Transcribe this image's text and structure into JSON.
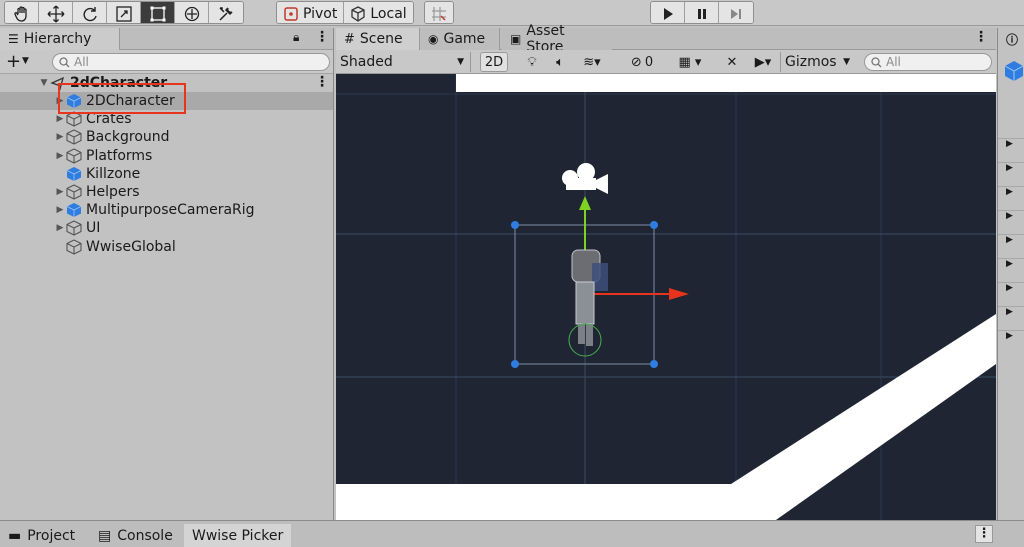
{
  "toolbar": {
    "tools": [
      "hand-tool",
      "move-tool",
      "rotate-tool",
      "scale-tool",
      "rect-tool",
      "transform-tool",
      "custom-tool"
    ],
    "pivot_label": "Pivot",
    "local_label": "Local"
  },
  "hierarchy": {
    "tab_label": "Hierarchy",
    "search_placeholder": "All",
    "scene_root": "2dCharacter",
    "items": [
      {
        "label": "2DCharacter",
        "icon": "blue-cube-icon",
        "expandable": true,
        "selected": true
      },
      {
        "label": "Crates",
        "icon": "outline-cube-icon",
        "expandable": true
      },
      {
        "label": "Background",
        "icon": "outline-cube-icon",
        "expandable": true
      },
      {
        "label": "Platforms",
        "icon": "outline-cube-icon",
        "expandable": true
      },
      {
        "label": "Killzone",
        "icon": "blue-cube-icon",
        "expandable": false
      },
      {
        "label": "Helpers",
        "icon": "outline-cube-icon",
        "expandable": true
      },
      {
        "label": "MultipurposeCameraRig",
        "icon": "blue-cube-icon",
        "expandable": true
      },
      {
        "label": "UI",
        "icon": "outline-cube-icon",
        "expandable": true
      },
      {
        "label": "WwiseGlobal",
        "icon": "outline-cube-icon",
        "expandable": false
      }
    ]
  },
  "scene": {
    "tabs": [
      "Scene",
      "Game",
      "Asset Store"
    ],
    "shading": "Shaded",
    "mode_2d": "2D",
    "hidden_count": "0",
    "gizmos": "Gizmos",
    "search_placeholder": "All"
  },
  "bottom": {
    "tabs": [
      "Project",
      "Console",
      "Wwise Picker"
    ]
  },
  "colors": {
    "viewport_bg": "#1f2533",
    "grid": "#3a4a66",
    "selection_highlight": "#e8341c",
    "x_axis": "#e8341c",
    "y_axis": "#7ed321",
    "handle": "#2f7de1"
  }
}
